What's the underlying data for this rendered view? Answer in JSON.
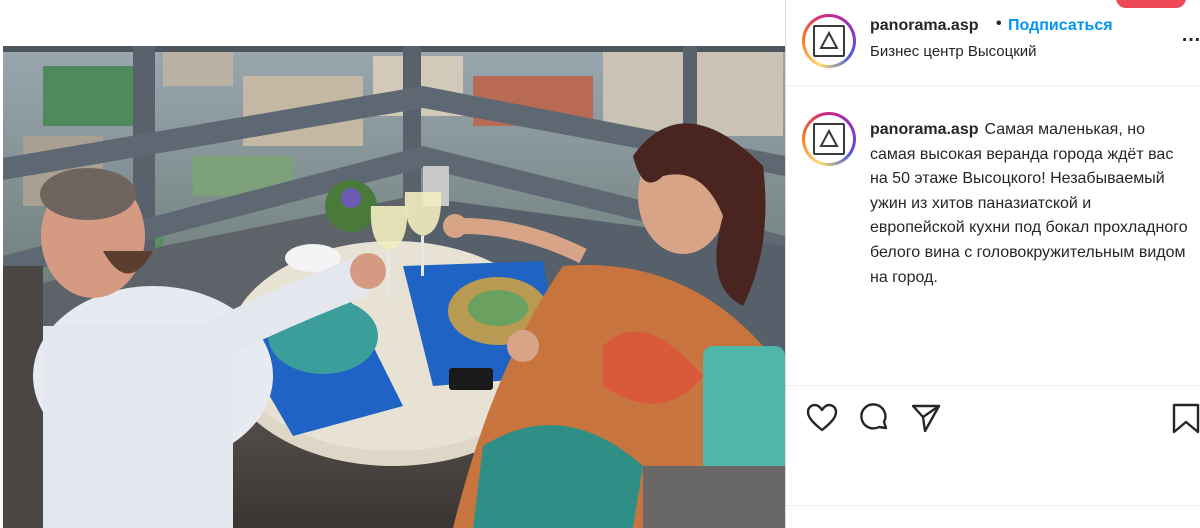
{
  "post": {
    "username": "panorama.asp",
    "separator": "•",
    "follow_label": "Подписаться",
    "location": "Бизнес центр Высоцкий",
    "more_icon": "more-horizontal-icon",
    "caption_text": "Самая маленькая, но самая высокая веранда города ждёт вас на 50 этаже Высоцкого! Незабываемый ужин из хитов паназиатской и европейской кухни под бокал прохладного белого вина с головокружительным видом на город."
  },
  "photo": {
    "description_icon": "post-photo",
    "accent_colors": {
      "sky_view": "#8a9aa8",
      "railing": "#59626c",
      "table": "#e6e0d3",
      "placemat": "#1f63c4"
    }
  },
  "actions": {
    "like_icon": "heart-icon",
    "comment_icon": "comment-icon",
    "share_icon": "share-icon",
    "save_icon": "bookmark-icon"
  },
  "colors": {
    "link_blue": "#0095f6",
    "text": "#262626",
    "divider": "#efefef"
  }
}
